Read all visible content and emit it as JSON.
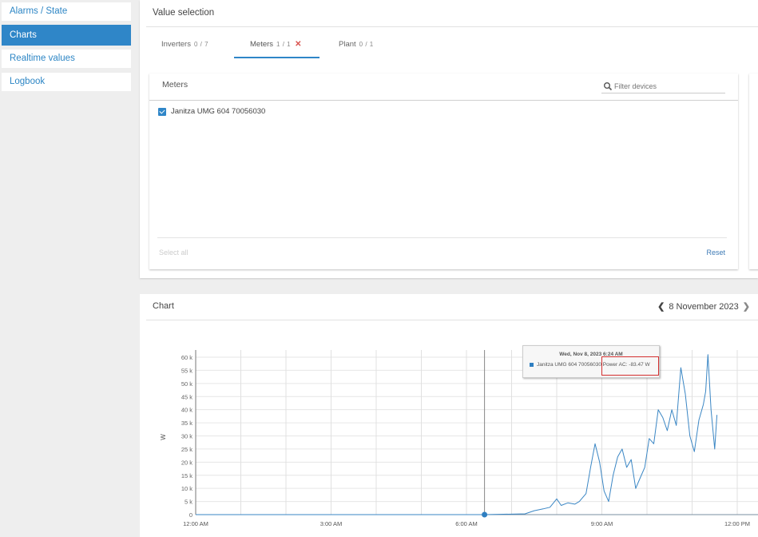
{
  "sidebar": {
    "items": [
      {
        "label": "Alarms / State",
        "active": false
      },
      {
        "label": "Charts",
        "active": true
      },
      {
        "label": "Realtime values",
        "active": false
      },
      {
        "label": "Logbook",
        "active": false
      }
    ]
  },
  "value_selection": {
    "title": "Value selection",
    "tabs": [
      {
        "label": "Inverters",
        "count": "0 / 7"
      },
      {
        "label": "Meters",
        "count": "1 / 1",
        "clear": "✕"
      },
      {
        "label": "Plant",
        "count": "0 / 1"
      }
    ],
    "meters": {
      "title": "Meters",
      "filter_placeholder": "Filter devices",
      "devices": [
        {
          "label": "Janitza UMG 604 70056030",
          "checked": true
        }
      ],
      "select_all": "Select all",
      "reset": "Reset"
    }
  },
  "chart_panel": {
    "title": "Chart",
    "date": "8 November 2023",
    "prev_icon": "‹",
    "next_icon": "›",
    "tooltip": {
      "date": "Wed, Nov 8, 2023 6:24 AM",
      "series": "Janitza UMG 604 70056030",
      "value": "Power AC: -83.47 W"
    }
  },
  "colors": {
    "accent": "#2f86c8",
    "series": "#3a86c4",
    "highlight": "#d32f2f"
  },
  "chart_data": {
    "type": "line",
    "title": "",
    "xlabel": "",
    "ylabel": "W",
    "x_unit": "hours since midnight",
    "xlim": [
      0,
      12
    ],
    "ylim": [
      0,
      60000
    ],
    "x_tick_labels": [
      "12:00 AM",
      "3:00 AM",
      "6:00 AM",
      "9:00 AM",
      "12:00 PM"
    ],
    "x_ticks": [
      0,
      3,
      6,
      9,
      12
    ],
    "y_ticks": [
      0,
      5000,
      10000,
      15000,
      20000,
      25000,
      30000,
      35000,
      40000,
      45000,
      50000,
      55000,
      60000
    ],
    "y_tick_labels": [
      "0",
      "5 k",
      "10 k",
      "15 k",
      "20 k",
      "25 k",
      "30 k",
      "35 k",
      "40 k",
      "45 k",
      "50 k",
      "55 k",
      "60 k"
    ],
    "grid": true,
    "legend": "none",
    "highlighted_point": {
      "x": 6.4,
      "y": -83.47
    },
    "series": [
      {
        "name": "Janitza UMG 604 70056030 Power AC",
        "x": [
          0,
          6.4,
          7.3,
          7.5,
          7.7,
          7.85,
          8.0,
          8.1,
          8.25,
          8.4,
          8.5,
          8.65,
          8.75,
          8.85,
          8.95,
          9.05,
          9.15,
          9.25,
          9.35,
          9.45,
          9.55,
          9.65,
          9.75,
          9.85,
          9.95,
          10.05,
          10.15,
          10.25,
          10.35,
          10.45,
          10.55,
          10.65,
          10.75,
          10.85,
          10.95,
          11.05,
          11.15,
          11.25,
          11.3,
          11.35,
          11.42,
          11.5,
          11.55
        ],
        "y": [
          0,
          -83,
          300,
          1500,
          2200,
          2800,
          6000,
          3500,
          4500,
          4000,
          5000,
          8000,
          18000,
          27000,
          20000,
          9000,
          5000,
          15000,
          22000,
          25000,
          18000,
          21000,
          10000,
          14000,
          18000,
          29000,
          27000,
          40000,
          37000,
          32000,
          40000,
          34000,
          56000,
          46000,
          30000,
          24000,
          36000,
          42000,
          47000,
          61000,
          40000,
          25000,
          38000
        ]
      }
    ]
  }
}
